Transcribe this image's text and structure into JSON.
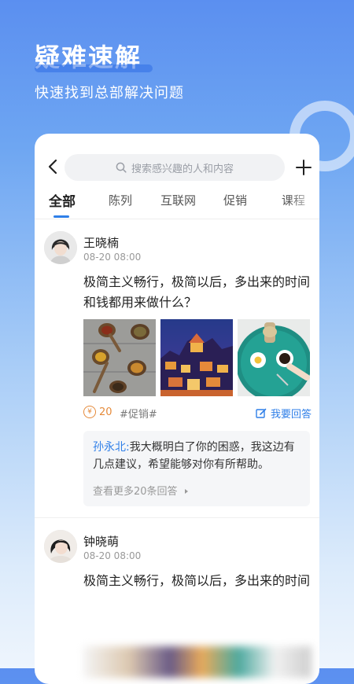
{
  "hero": {
    "title": "疑难速解",
    "subtitle": "快速找到总部解决问题"
  },
  "search": {
    "placeholder": "搜索感兴趣的人和内容"
  },
  "tabs": [
    {
      "label": "全部",
      "active": true
    },
    {
      "label": "陈列",
      "active": false
    },
    {
      "label": "互联网",
      "active": false
    },
    {
      "label": "促销",
      "active": false
    },
    {
      "label": "课程",
      "active": false
    }
  ],
  "posts": [
    {
      "author": "王晓楠",
      "time": "08-20 08:00",
      "question": "极简主义畅行，极简以后，多出来的时间和钱都用来做什么？",
      "reward_symbol": "¥",
      "reward": "20",
      "tag": "#促销#",
      "answer_label": "我要回答",
      "reply": {
        "author": "孙永北:",
        "text": "我大概明白了你的困惑，我这边有几点建议，希望能够对你有所帮助。",
        "more": "查看更多20条回答"
      }
    },
    {
      "author": "钟晓萌",
      "time": "08-20 08:00",
      "question": "极简主义畅行，极简以后，多出来的时间"
    }
  ],
  "colors": {
    "accent": "#2f7fe8",
    "reward": "#e58a3a",
    "background_top": "#5b8ff0",
    "background_bottom": "#eef5fd"
  }
}
